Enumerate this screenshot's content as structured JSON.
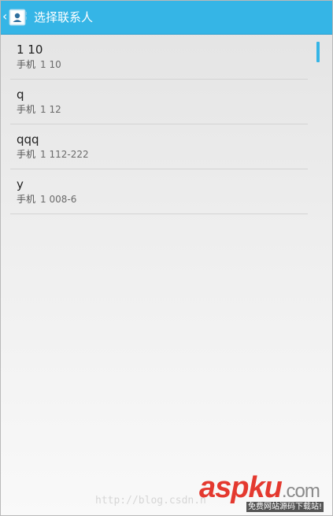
{
  "action_bar": {
    "title": "选择联系人",
    "up_icon": "chevron-left-icon",
    "app_icon": "contacts-app-icon",
    "color": "#35b5e6"
  },
  "contacts": [
    {
      "name": "1 10",
      "type": "手机",
      "number": "1 10"
    },
    {
      "name": "q",
      "type": "手机",
      "number": "1 12"
    },
    {
      "name": "qqq",
      "type": "手机",
      "number": "1 112-222"
    },
    {
      "name": "y",
      "type": "手机",
      "number": "1 008-6"
    }
  ],
  "watermark": {
    "url": "http://blog.csdn.n",
    "logo_main": "aspku",
    "logo_suffix": ".com",
    "caption": "免费网站源码下载站!"
  }
}
